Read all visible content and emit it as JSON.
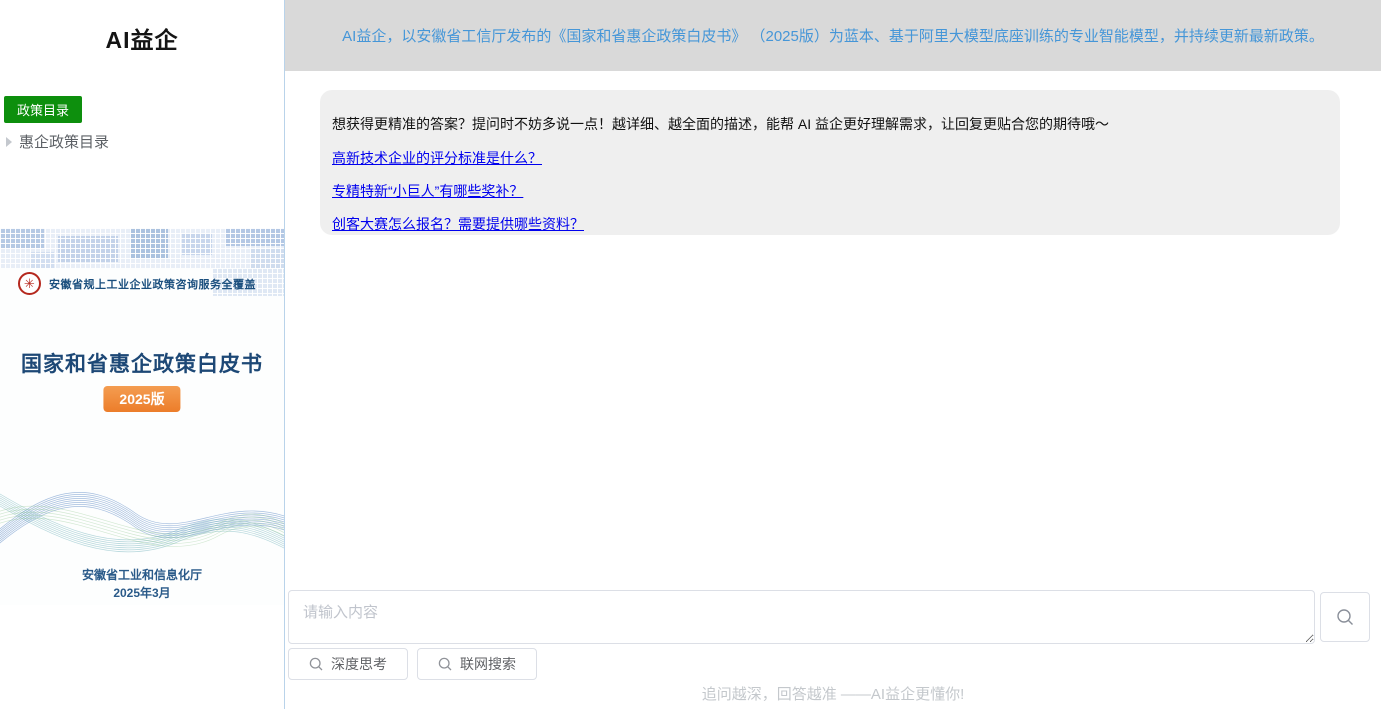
{
  "sidebar": {
    "logo": "AI益企",
    "policy_button_label": "政策目录",
    "tree_item_label": "惠企政策目录",
    "cover": {
      "emblem_tagline": "安徽省规上工业企业政策咨询服务全覆盖",
      "title": "国家和省惠企政策白皮书",
      "edition_badge": "2025版",
      "agency": "安徽省工业和信息化厅",
      "date": "2025年3月"
    }
  },
  "banner": {
    "text": "AI益企，以安徽省工信厅发布的《国家和省惠企政策白皮书》 （2025版）为蓝本、基于阿里大模型底座训练的专业智能模型，并持续更新最新政策。"
  },
  "welcome": {
    "message": "想获得更精准的答案？提问时不妨多说一点！越详细、越全面的描述，能帮 AI 益企更好理解需求，让回复更贴合您的期待哦～",
    "questions": [
      "高新技术企业的评分标准是什么？",
      "专精特新“小巨人”有哪些奖补？",
      "创客大赛怎么报名？需要提供哪些资料？"
    ]
  },
  "composer": {
    "placeholder": "请输入内容",
    "deep_think_label": "深度思考",
    "web_search_label": "联网搜索"
  },
  "footer": {
    "tagline": "追问越深，回答越准 ——AI益企更懂你!"
  },
  "icons": {
    "send": "search-icon",
    "deep_think": "search-icon",
    "web_search": "search-icon",
    "tree_caret": "chevron-right-icon",
    "emblem": "government-seal-icon"
  },
  "colors": {
    "banner_bg": "#d9d9d9",
    "banner_text": "#4596d8",
    "green_button": "#0d8f0d",
    "link_blue": "#0000ee",
    "message_box_bg": "#efefef",
    "cover_title_navy": "#1d4876",
    "badge_orange": "#ec7d2a",
    "emblem_red": "#b5281e"
  }
}
